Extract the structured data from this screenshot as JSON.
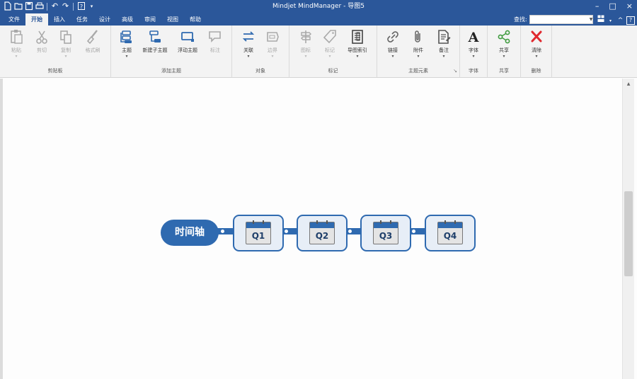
{
  "window": {
    "title": "Mindjet MindManager - 导图5"
  },
  "qat": {
    "icons": [
      "new-doc-icon",
      "open-icon",
      "save-icon",
      "print-icon",
      "undo-icon",
      "redo-icon",
      "help-icon"
    ]
  },
  "tabs": [
    {
      "label": "文件"
    },
    {
      "label": "开始",
      "active": true
    },
    {
      "label": "插入"
    },
    {
      "label": "任务"
    },
    {
      "label": "设计"
    },
    {
      "label": "高级"
    },
    {
      "label": "审阅"
    },
    {
      "label": "视图"
    },
    {
      "label": "帮助"
    }
  ],
  "search": {
    "label": "查找:",
    "value": ""
  },
  "window_controls": {
    "minimize": "–",
    "maximize": "□",
    "close": "×"
  },
  "ribbon": {
    "clipboard": {
      "label": "剪贴板",
      "buttons": [
        "粘贴",
        "剪切",
        "复制",
        "格式刷"
      ]
    },
    "add_topic": {
      "label": "添加主题",
      "buttons": [
        "主题",
        "新建子主题",
        "浮动主题",
        "标注"
      ]
    },
    "objects": {
      "label": "对象",
      "buttons": [
        "关联",
        "边界"
      ]
    },
    "markers": {
      "label": "标记",
      "buttons": [
        "图标",
        "标记",
        "导图索引"
      ]
    },
    "topic_elements": {
      "label": "主题元素",
      "buttons": [
        "链接",
        "附件",
        "备注"
      ]
    },
    "font": {
      "label": "字体",
      "buttons": [
        "字体"
      ]
    },
    "share": {
      "label": "共享",
      "buttons": [
        "共享"
      ]
    },
    "delete": {
      "label": "删除",
      "buttons": [
        "清除"
      ]
    }
  },
  "mindmap": {
    "central_topic": "时间轴",
    "subtopics": [
      "Q1",
      "Q2",
      "Q3",
      "Q4"
    ],
    "accent": "#2f6ab0"
  },
  "colors": {
    "titlebar": "#2b579a",
    "ribbon": "#f3f3f3",
    "delete_red": "#e0282e"
  }
}
